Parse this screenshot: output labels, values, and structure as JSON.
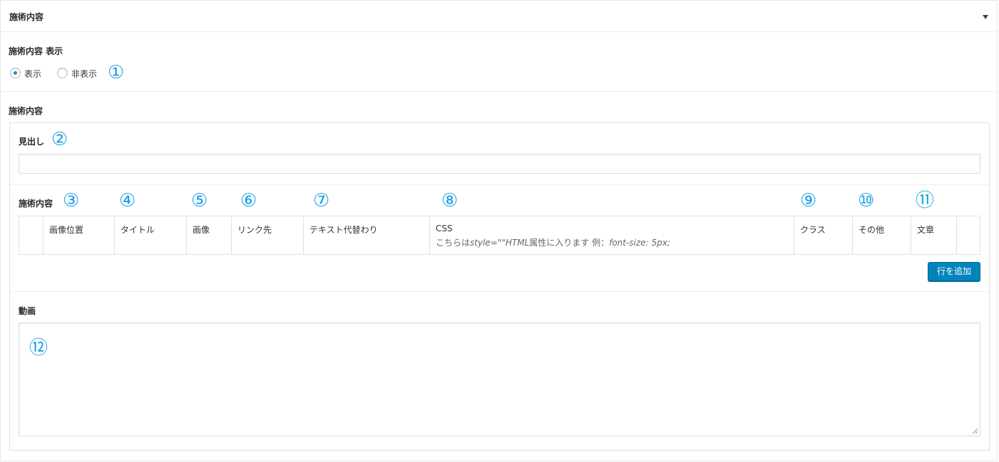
{
  "panel": {
    "title": "施術内容"
  },
  "display_field": {
    "label": "施術内容 表示",
    "options": [
      {
        "label": "表示",
        "checked": true
      },
      {
        "label": "非表示",
        "checked": false
      }
    ]
  },
  "group": {
    "label": "施術内容"
  },
  "heading_field": {
    "label": "見出し",
    "value": ""
  },
  "repeater": {
    "label": "施術内容",
    "columns": [
      {
        "label": "画像位置"
      },
      {
        "label": "タイトル"
      },
      {
        "label": "画像"
      },
      {
        "label": "リンク先"
      },
      {
        "label": "テキスト代替わり"
      },
      {
        "label": "CSS",
        "sub_prefix": "こちらは",
        "sub_italic1": "style=\"\"HTML",
        "sub_mid": "属性に入ります 例：",
        "sub_italic2": "font-size: 5px;"
      },
      {
        "label": "クラス"
      },
      {
        "label": "その他"
      },
      {
        "label": "文章"
      }
    ],
    "add_row_label": "行を追加"
  },
  "video_field": {
    "label": "動画",
    "value": ""
  },
  "badges": [
    "①",
    "②",
    "③",
    "④",
    "⑤",
    "⑥",
    "⑦",
    "⑧",
    "⑨",
    "⑩",
    "⑪",
    "⑫"
  ],
  "colors": {
    "accent": "#0085ba",
    "badge": "#18a0e6"
  },
  "icons": {
    "toggle": "triangle-down-icon"
  }
}
